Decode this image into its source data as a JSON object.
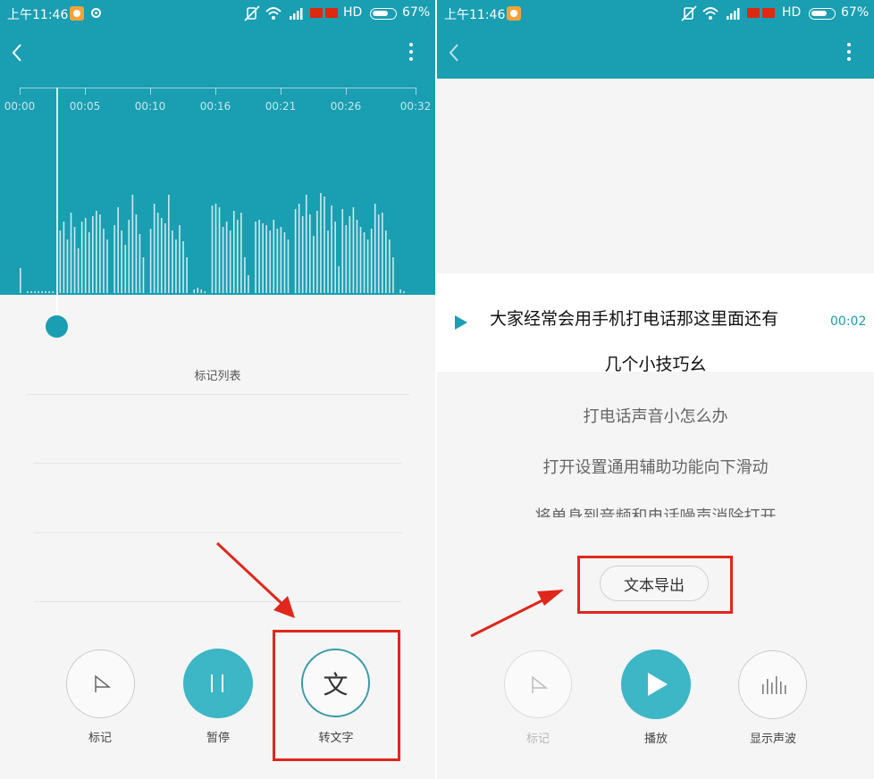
{
  "left": {
    "status": {
      "time": "上午11:46",
      "network": "HD",
      "battery": "67%",
      "battery_level": 0.67
    },
    "timeline": {
      "ticks": [
        "00:00",
        "00:05",
        "00:10",
        "00:16",
        "00:21",
        "00:26",
        "00:32"
      ]
    },
    "marks_list_title": "标记列表",
    "controls": {
      "mark": "标记",
      "pause": "暂停",
      "to_text": "转文字"
    },
    "icons": {
      "back": "chevron-left-icon",
      "menu": "more-vertical-icon",
      "mark": "flag-triangle-icon",
      "pause": "pause-icon",
      "to_text": "wen-character-icon",
      "to_text_glyph": "文"
    },
    "colors": {
      "header": "#1a9eb1",
      "accent": "#3db6c6",
      "annotation": "#e0271c"
    }
  },
  "right": {
    "status": {
      "time": "上午11:46",
      "network": "HD",
      "battery": "67%",
      "battery_level": 0.67
    },
    "transcript": {
      "current_line_1": "大家经常会用手机打电话那这里面还有",
      "current_line_2": "几个小技巧幺",
      "current_time": "00:02",
      "next_lines": [
        "打电话声音小怎么办",
        "打开设置通用辅助功能向下滑动",
        "将单身到音频和电话噪声消除打开"
      ]
    },
    "export_button": "文本导出",
    "controls": {
      "mark": "标记",
      "play": "播放",
      "show_waveform": "显示声波"
    },
    "icons": {
      "back": "chevron-left-icon",
      "menu": "more-vertical-icon",
      "mark": "flag-triangle-icon",
      "play": "play-icon",
      "waveform": "waveform-icon"
    }
  }
}
